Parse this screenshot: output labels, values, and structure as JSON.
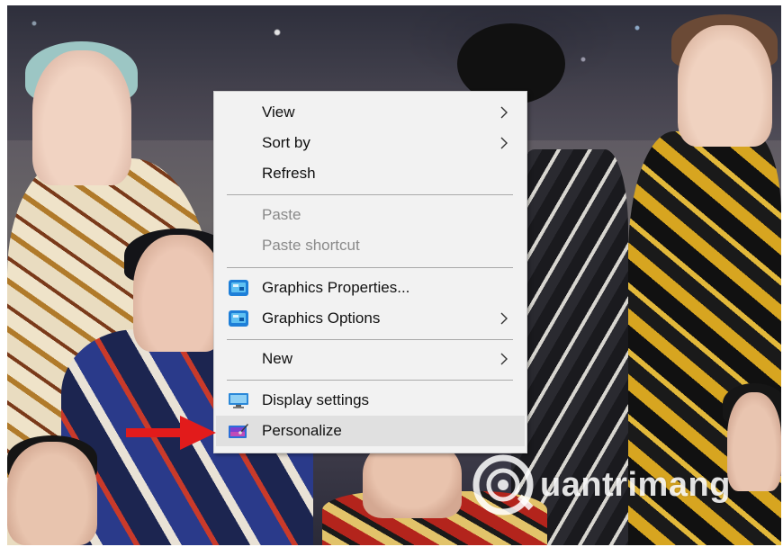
{
  "menu": {
    "items": [
      {
        "label": "View"
      },
      {
        "label": "Sort by"
      },
      {
        "label": "Refresh"
      },
      {
        "label": "Paste"
      },
      {
        "label": "Paste shortcut"
      },
      {
        "label": "Graphics Properties..."
      },
      {
        "label": "Graphics Options"
      },
      {
        "label": "New"
      },
      {
        "label": "Display settings"
      },
      {
        "label": "Personalize"
      }
    ],
    "highlight_color": "#e0e0e0",
    "disabled_color": "#8a8a8a"
  },
  "annotation": {
    "arrow_color": "#e21b1b"
  },
  "watermark": {
    "text": "uantrimang"
  }
}
